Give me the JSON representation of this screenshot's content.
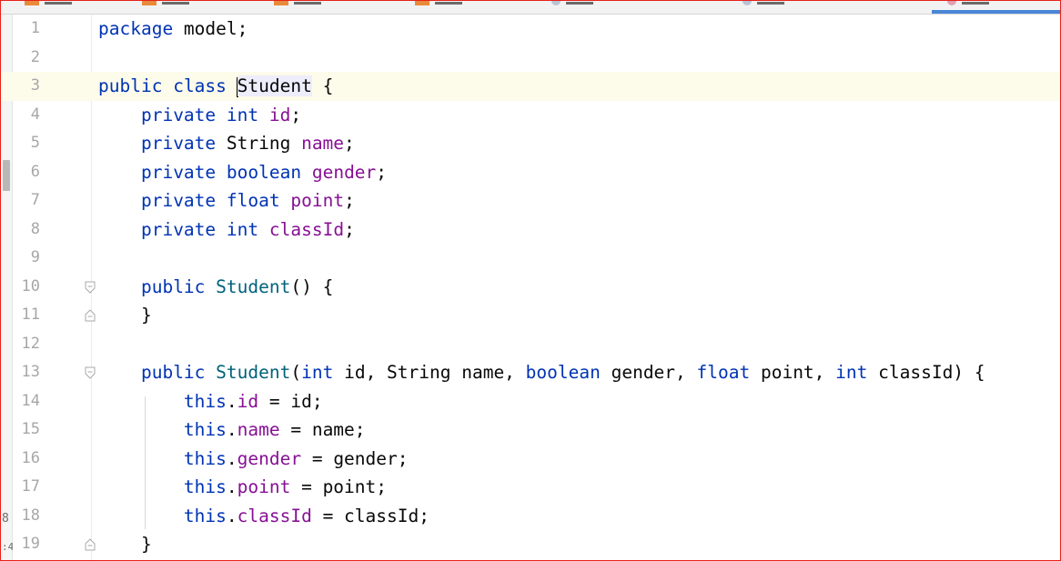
{
  "editor": {
    "language": "Java",
    "current_line": 3,
    "side_marks": [
      "8",
      ":4"
    ],
    "lines": [
      {
        "num": "1",
        "tokens": [
          {
            "t": "package",
            "c": "kw"
          },
          {
            "t": " model;",
            "c": ""
          }
        ]
      },
      {
        "num": "2",
        "tokens": []
      },
      {
        "num": "3",
        "tokens": [
          {
            "t": "public",
            "c": "kw"
          },
          {
            "t": " ",
            "c": ""
          },
          {
            "t": "class",
            "c": "kw"
          },
          {
            "t": " ",
            "c": ""
          },
          {
            "t": "",
            "c": "caret"
          },
          {
            "t": "Student",
            "c": "cls-hl"
          },
          {
            "t": " {",
            "c": ""
          }
        ]
      },
      {
        "num": "4",
        "tokens": [
          {
            "t": "    ",
            "c": ""
          },
          {
            "t": "private",
            "c": "kw"
          },
          {
            "t": " ",
            "c": ""
          },
          {
            "t": "int",
            "c": "kw"
          },
          {
            "t": " ",
            "c": ""
          },
          {
            "t": "id",
            "c": "fld"
          },
          {
            "t": ";",
            "c": ""
          }
        ]
      },
      {
        "num": "5",
        "tokens": [
          {
            "t": "    ",
            "c": ""
          },
          {
            "t": "private",
            "c": "kw"
          },
          {
            "t": " String ",
            "c": ""
          },
          {
            "t": "name",
            "c": "fld"
          },
          {
            "t": ";",
            "c": ""
          }
        ]
      },
      {
        "num": "6",
        "tokens": [
          {
            "t": "    ",
            "c": ""
          },
          {
            "t": "private",
            "c": "kw"
          },
          {
            "t": " ",
            "c": ""
          },
          {
            "t": "boolean",
            "c": "kw"
          },
          {
            "t": " ",
            "c": ""
          },
          {
            "t": "gender",
            "c": "fld"
          },
          {
            "t": ";",
            "c": ""
          }
        ]
      },
      {
        "num": "7",
        "tokens": [
          {
            "t": "    ",
            "c": ""
          },
          {
            "t": "private",
            "c": "kw"
          },
          {
            "t": " ",
            "c": ""
          },
          {
            "t": "float",
            "c": "kw"
          },
          {
            "t": " ",
            "c": ""
          },
          {
            "t": "point",
            "c": "fld"
          },
          {
            "t": ";",
            "c": ""
          }
        ]
      },
      {
        "num": "8",
        "tokens": [
          {
            "t": "    ",
            "c": ""
          },
          {
            "t": "private",
            "c": "kw"
          },
          {
            "t": " ",
            "c": ""
          },
          {
            "t": "int",
            "c": "kw"
          },
          {
            "t": " ",
            "c": ""
          },
          {
            "t": "classId",
            "c": "fld"
          },
          {
            "t": ";",
            "c": ""
          }
        ]
      },
      {
        "num": "9",
        "tokens": []
      },
      {
        "num": "10",
        "fold": "open",
        "tokens": [
          {
            "t": "    ",
            "c": ""
          },
          {
            "t": "public",
            "c": "kw"
          },
          {
            "t": " ",
            "c": ""
          },
          {
            "t": "Student",
            "c": "fn"
          },
          {
            "t": "() {",
            "c": ""
          }
        ]
      },
      {
        "num": "11",
        "fold": "close",
        "tokens": [
          {
            "t": "    }",
            "c": ""
          }
        ]
      },
      {
        "num": "12",
        "tokens": []
      },
      {
        "num": "13",
        "fold": "open",
        "tokens": [
          {
            "t": "    ",
            "c": ""
          },
          {
            "t": "public",
            "c": "kw"
          },
          {
            "t": " ",
            "c": ""
          },
          {
            "t": "Student",
            "c": "fn"
          },
          {
            "t": "(",
            "c": ""
          },
          {
            "t": "int",
            "c": "kw"
          },
          {
            "t": " id, String name, ",
            "c": ""
          },
          {
            "t": "boolean",
            "c": "kw"
          },
          {
            "t": " gender, ",
            "c": ""
          },
          {
            "t": "float",
            "c": "kw"
          },
          {
            "t": " point, ",
            "c": ""
          },
          {
            "t": "int",
            "c": "kw"
          },
          {
            "t": " classId) {",
            "c": ""
          }
        ]
      },
      {
        "num": "14",
        "tokens": [
          {
            "t": "        ",
            "c": ""
          },
          {
            "t": "this",
            "c": "kw"
          },
          {
            "t": ".",
            "c": ""
          },
          {
            "t": "id",
            "c": "fld"
          },
          {
            "t": " = id;",
            "c": ""
          }
        ]
      },
      {
        "num": "15",
        "tokens": [
          {
            "t": "        ",
            "c": ""
          },
          {
            "t": "this",
            "c": "kw"
          },
          {
            "t": ".",
            "c": ""
          },
          {
            "t": "name",
            "c": "fld"
          },
          {
            "t": " = name;",
            "c": ""
          }
        ]
      },
      {
        "num": "16",
        "tokens": [
          {
            "t": "        ",
            "c": ""
          },
          {
            "t": "this",
            "c": "kw"
          },
          {
            "t": ".",
            "c": ""
          },
          {
            "t": "gender",
            "c": "fld"
          },
          {
            "t": " = gender;",
            "c": ""
          }
        ]
      },
      {
        "num": "17",
        "tokens": [
          {
            "t": "        ",
            "c": ""
          },
          {
            "t": "this",
            "c": "kw"
          },
          {
            "t": ".",
            "c": ""
          },
          {
            "t": "point",
            "c": "fld"
          },
          {
            "t": " = point;",
            "c": ""
          }
        ]
      },
      {
        "num": "18",
        "tokens": [
          {
            "t": "        ",
            "c": ""
          },
          {
            "t": "this",
            "c": "kw"
          },
          {
            "t": ".",
            "c": ""
          },
          {
            "t": "classId",
            "c": "fld"
          },
          {
            "t": " = classId;",
            "c": ""
          }
        ]
      },
      {
        "num": "19",
        "fold": "close",
        "tokens": [
          {
            "t": "    }",
            "c": ""
          }
        ]
      }
    ]
  },
  "colors": {
    "keyword": "#0033b3",
    "field": "#871094",
    "method": "#00627a",
    "plain": "#080808",
    "line_number": "#a7a7a7",
    "current_line_bg": "#fdfbea",
    "frame_border": "#e8201a",
    "active_tab": "#4a86d8"
  }
}
